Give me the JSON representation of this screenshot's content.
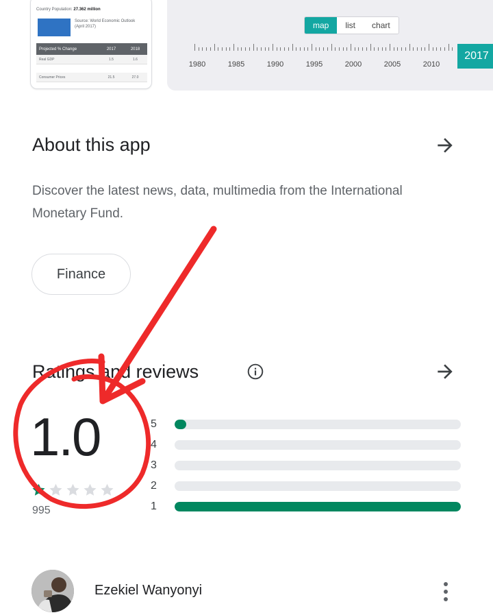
{
  "screenshots": {
    "shot1": {
      "population_label": "Country Population:",
      "population_value": "27.362 million",
      "thumb_caption": "Source: World Economic Outlook (April 2017)",
      "table": {
        "headers": [
          "Projected % Change",
          "2017",
          "2018"
        ],
        "rows": [
          [
            "Real GDP",
            "1.5",
            "1.6"
          ],
          [
            "Consumer Prices",
            "21.5",
            "27.0"
          ]
        ]
      }
    },
    "shot2": {
      "tabs": [
        "map",
        "list",
        "chart"
      ],
      "active_tab": "map",
      "years": [
        "1980",
        "1985",
        "1990",
        "1995",
        "2000",
        "2005",
        "2010"
      ],
      "selected_year": "2017",
      "accent": "#13a7a2"
    }
  },
  "about": {
    "title": "About this app",
    "description": "Discover the latest news, data, multimedia from the International Monetary Fund.",
    "category_chip": "Finance"
  },
  "ratings": {
    "title": "Ratings and reviews",
    "average": "1.0",
    "stars_filled": 1,
    "stars_total": 5,
    "count": "995",
    "distribution": [
      {
        "label": "5",
        "fraction": 0.02
      },
      {
        "label": "4",
        "fraction": 0.0
      },
      {
        "label": "3",
        "fraction": 0.0
      },
      {
        "label": "2",
        "fraction": 0.0
      },
      {
        "label": "1",
        "fraction": 1.0
      }
    ],
    "bar_color": "#01875f"
  },
  "review": {
    "reviewer_name": "Ezekiel Wanyonyi"
  },
  "annotation_color": "#ee2a2a"
}
